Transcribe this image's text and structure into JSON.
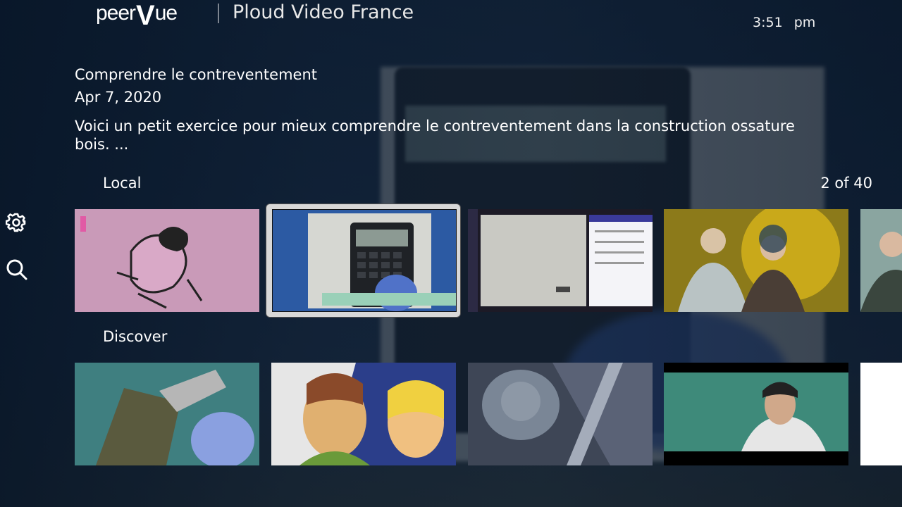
{
  "brand": {
    "logo_text_left": "peer",
    "logo_text_v": "V",
    "logo_text_right": "ue"
  },
  "header": {
    "instance_name": "Ploud Video France",
    "time": "3:51",
    "ampm": "pm"
  },
  "video": {
    "title": "Comprendre le contreventement",
    "date": "Apr 7, 2020",
    "description": "Voici un petit exercice pour mieux comprendre le contreventement dans la construction ossature bois. ..."
  },
  "rows": {
    "local": {
      "label": "Local",
      "counter": "2 of 40"
    },
    "discover": {
      "label": "Discover"
    }
  },
  "sidebar": {
    "icons": [
      "gear-icon",
      "search-icon"
    ]
  },
  "colors": {
    "background": "#0b1a2e",
    "focus_frame": "#d8d8d8",
    "text": "#ffffff"
  }
}
